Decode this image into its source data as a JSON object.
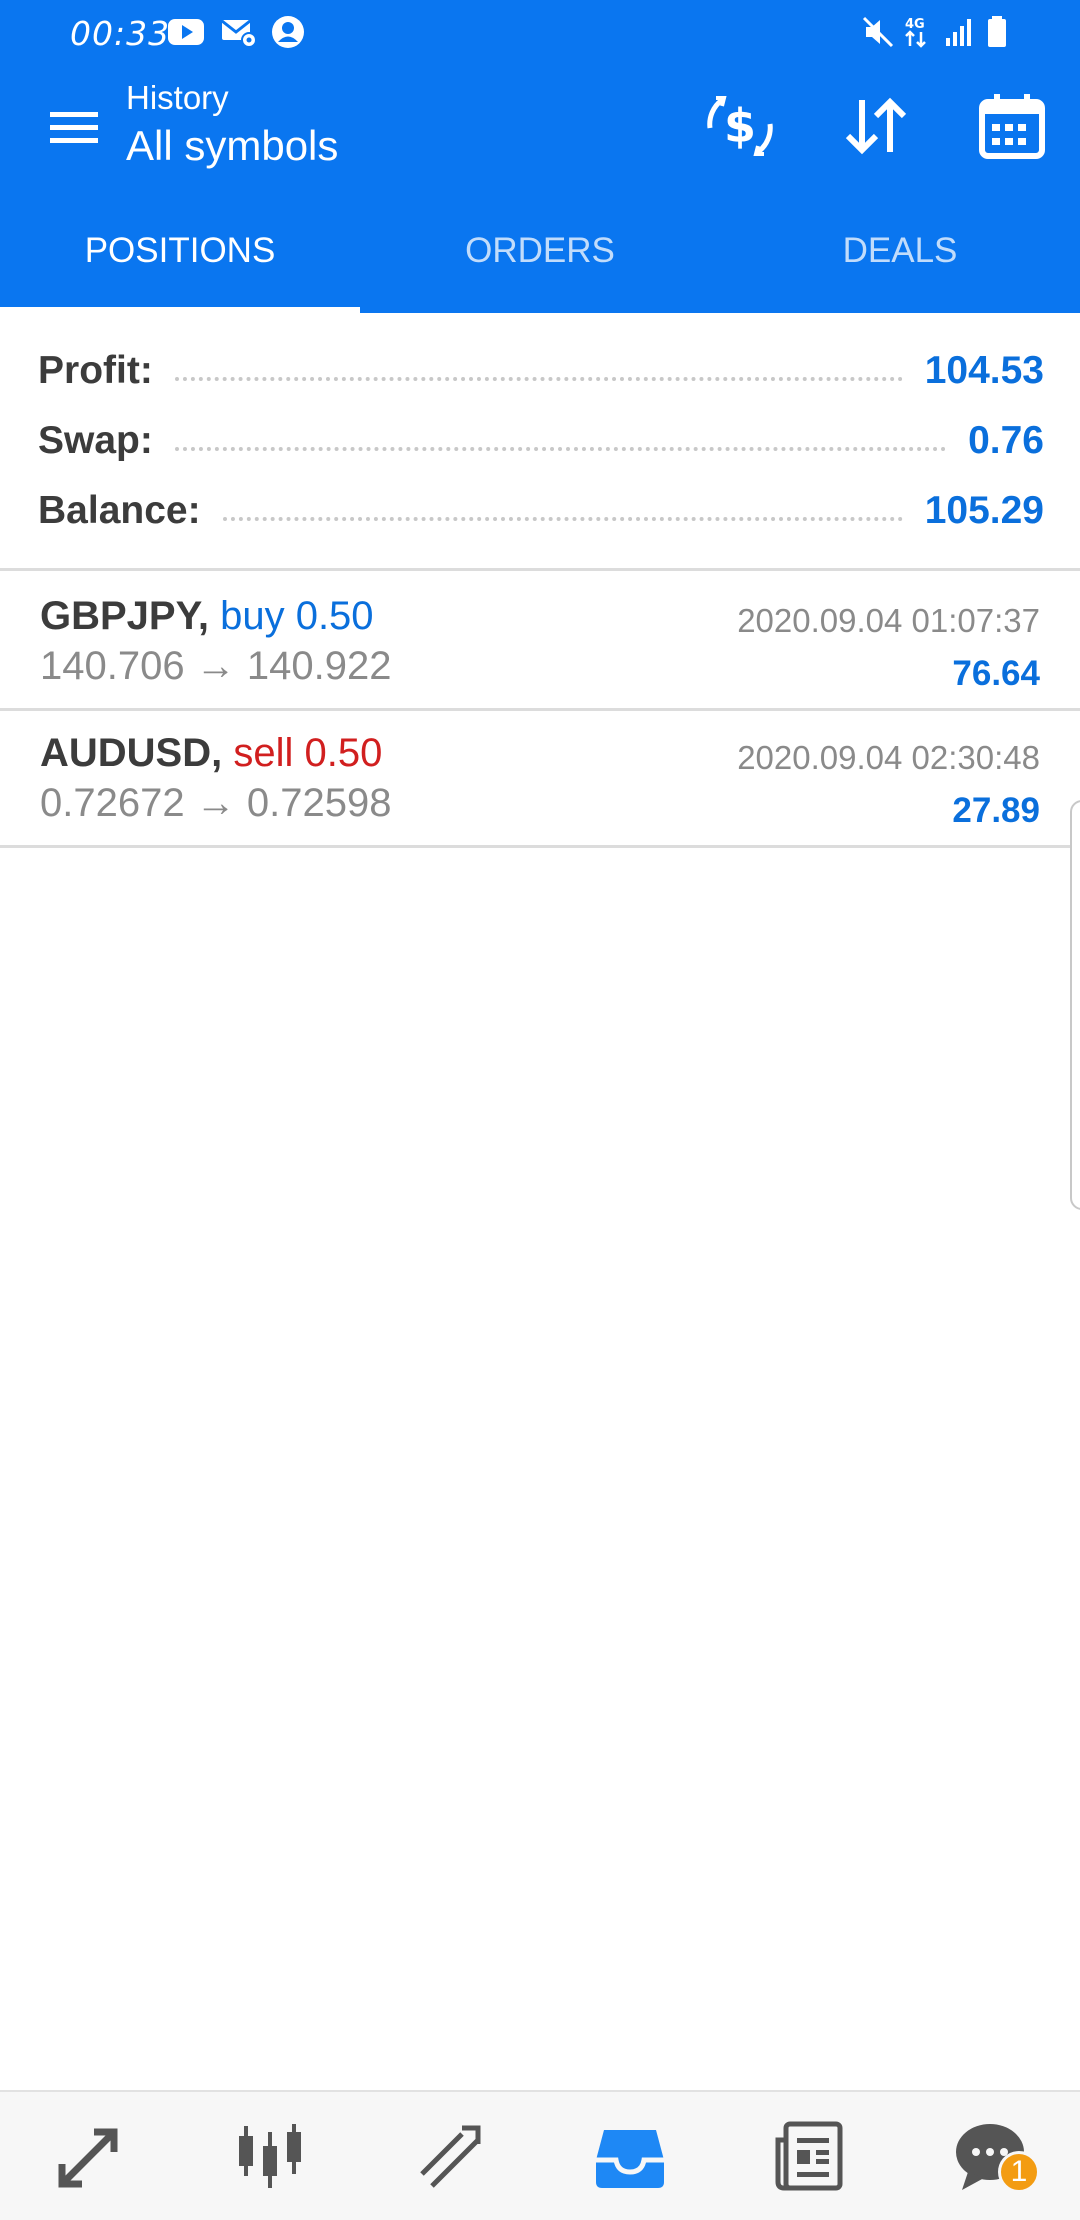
{
  "status_bar": {
    "time": "00:33",
    "network": "4G"
  },
  "toolbar": {
    "subtitle": "History",
    "title": "All symbols"
  },
  "tabs": [
    {
      "label": "POSITIONS",
      "active": true
    },
    {
      "label": "ORDERS",
      "active": false
    },
    {
      "label": "DEALS",
      "active": false
    }
  ],
  "summary": {
    "profit_label": "Profit:",
    "profit_value": "104.53",
    "swap_label": "Swap:",
    "swap_value": "0.76",
    "balance_label": "Balance:",
    "balance_value": "105.29"
  },
  "deals": [
    {
      "symbol": "GBPJPY,",
      "side": "buy 0.50",
      "open_price": "140.706",
      "arrow": "→",
      "close_price": "140.922",
      "time": "2020.09.04 01:07:37",
      "profit": "76.64"
    },
    {
      "symbol": "AUDUSD,",
      "side": "sell 0.50",
      "open_price": "0.72672",
      "arrow": "→",
      "close_price": "0.72598",
      "time": "2020.09.04 02:30:48",
      "profit": "27.89"
    }
  ],
  "bottom_nav": {
    "items": [
      "quotes-icon",
      "chart-icon",
      "trade-icon",
      "history-icon",
      "news-icon",
      "messages-icon"
    ],
    "active": "history-icon",
    "messages_badge": "1"
  },
  "colors": {
    "primary": "#0a76f0",
    "buy": "#0a6fdc",
    "sell": "#d11f1f",
    "badge": "#f39c12"
  }
}
